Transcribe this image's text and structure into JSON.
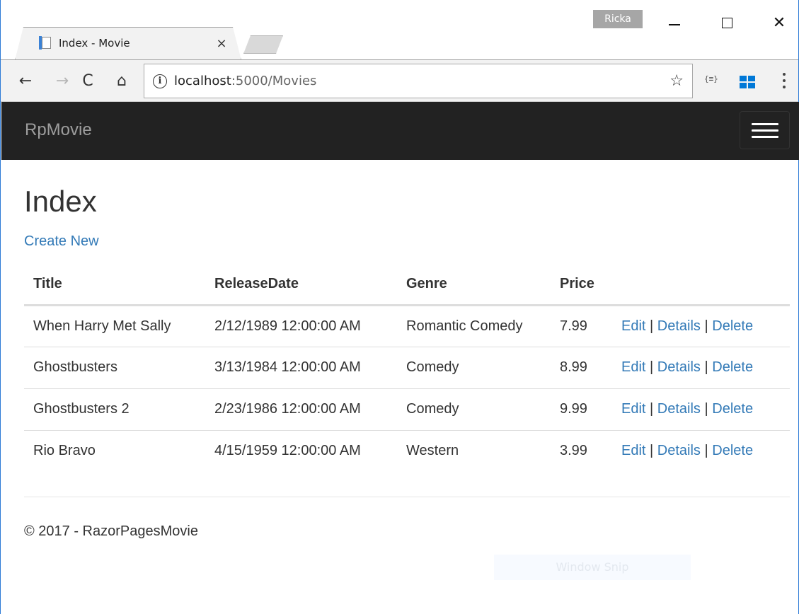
{
  "browser": {
    "tab_title": "Index - Movie",
    "tab_close": "×",
    "profile_name": "Ricka",
    "url_host": "localhost",
    "url_rest": ":5000/Movies",
    "close_glyph": "✕"
  },
  "icons": {
    "back": "←",
    "forward": "→",
    "reload": "C",
    "home": "⌂",
    "info": "i",
    "star": "☆",
    "extension": "{≡}"
  },
  "navbar": {
    "brand": "RpMovie"
  },
  "page": {
    "title": "Index",
    "create_link": "Create New"
  },
  "table": {
    "headers": [
      "Title",
      "ReleaseDate",
      "Genre",
      "Price",
      ""
    ],
    "rows": [
      {
        "title": "When Harry Met Sally",
        "release_date": "2/12/1989 12:00:00 AM",
        "genre": "Romantic Comedy",
        "price": "7.99"
      },
      {
        "title": "Ghostbusters",
        "release_date": "3/13/1984 12:00:00 AM",
        "genre": "Comedy",
        "price": "8.99"
      },
      {
        "title": "Ghostbusters 2",
        "release_date": "2/23/1986 12:00:00 AM",
        "genre": "Comedy",
        "price": "9.99"
      },
      {
        "title": "Rio Bravo",
        "release_date": "4/15/1959 12:00:00 AM",
        "genre": "Western",
        "price": "3.99"
      }
    ],
    "actions": {
      "edit": "Edit",
      "details": "Details",
      "delete": "Delete",
      "separator": "|"
    }
  },
  "footer": {
    "text": "© 2017 - RazorPagesMovie"
  },
  "overlay": {
    "snip_label": "Window Snip"
  },
  "colors": {
    "navbar_bg": "#222222",
    "link": "#337ab7",
    "brand": "#9d9d9d",
    "window_border": "#2b79d6"
  }
}
